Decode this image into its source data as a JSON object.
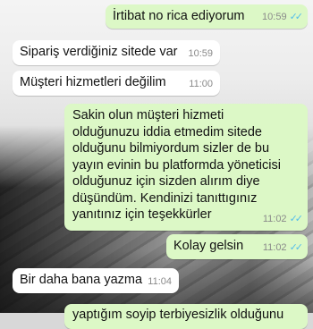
{
  "messages": [
    {
      "dir": "out",
      "text": "İrtibat no rica ediyorum",
      "time": "10:59",
      "read_icon": "double-check-icon"
    },
    {
      "dir": "in",
      "text": "Sipariş verdiğiniz sitede var",
      "time": "10:59"
    },
    {
      "dir": "in",
      "text": "Müşteri hizmetleri değilim",
      "time": "11:00"
    },
    {
      "dir": "out",
      "text": "Sakin olun müşteri hizmeti\nolduğunuzu iddia etmedim sitede\nolduğunu bilmiyordum sizler de bu\nyayın evinin bu platformda yöneticisi\nolduğunuz için sizden alırım diye\ndüşündüm. Kendinizi tanıttıgınız\nyanıtınız için teşekkürler",
      "time": "11:02",
      "read_icon": "double-check-icon"
    },
    {
      "dir": "out",
      "text": "Kolay gelsin",
      "time": "11:02",
      "read_icon": "double-check-icon"
    },
    {
      "dir": "in",
      "text": "Bir daha bana yazma",
      "time": "11:04"
    },
    {
      "dir": "out",
      "text": "yaptığım soyip terbiyesizlik olduğunu",
      "time": "",
      "partial": true
    }
  ],
  "colors": {
    "incoming_bubble": "#ffffff",
    "outgoing_bubble": "#dcf8c6",
    "read_ticks": "#53bdeb",
    "timestamp": "#8a8a8a"
  }
}
